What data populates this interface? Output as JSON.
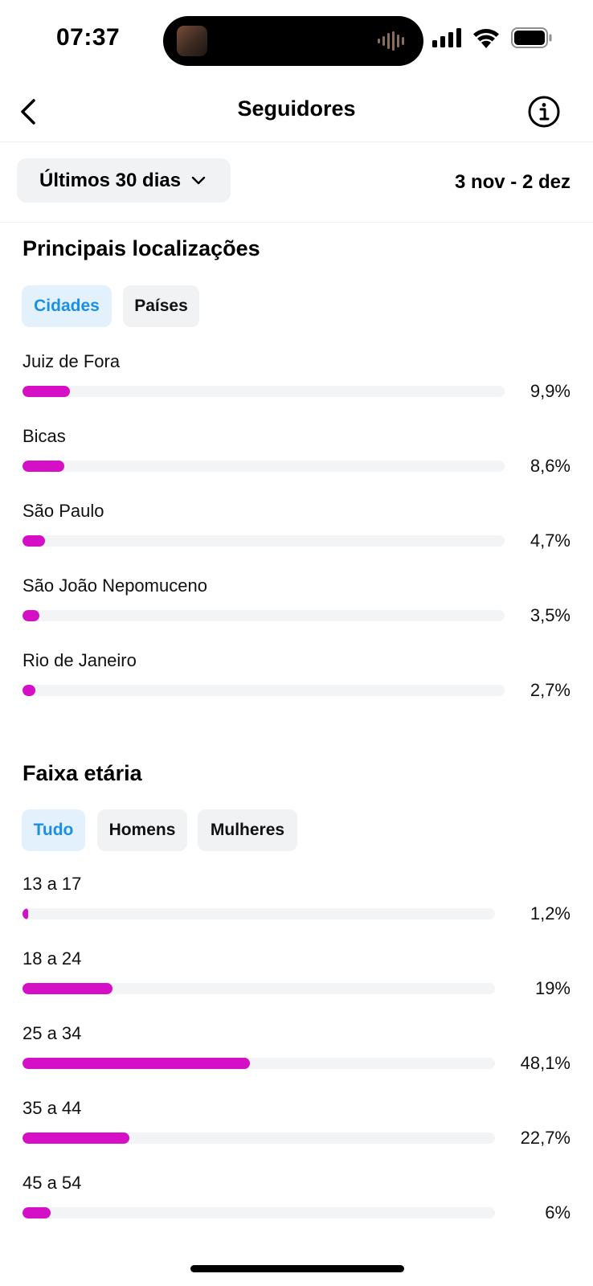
{
  "status_bar": {
    "time": "07:37"
  },
  "header": {
    "title": "Seguidores"
  },
  "filter": {
    "range_label": "Últimos 30 dias",
    "date_range": "3 nov - 2 dez"
  },
  "locations": {
    "title": "Principais localizações",
    "tabs": [
      {
        "label": "Cidades",
        "active": true
      },
      {
        "label": "Países",
        "active": false
      }
    ],
    "rows": [
      {
        "label": "Juiz de Fora",
        "percent_text": "9,9%",
        "value": 9.9
      },
      {
        "label": "Bicas",
        "percent_text": "8,6%",
        "value": 8.6
      },
      {
        "label": "São Paulo",
        "percent_text": "4,7%",
        "value": 4.7
      },
      {
        "label": "São João Nepomuceno",
        "percent_text": "3,5%",
        "value": 3.5
      },
      {
        "label": "Rio de Janeiro",
        "percent_text": "2,7%",
        "value": 2.7
      }
    ]
  },
  "age": {
    "title": "Faixa etária",
    "tabs": [
      {
        "label": "Tudo",
        "active": true
      },
      {
        "label": "Homens",
        "active": false
      },
      {
        "label": "Mulheres",
        "active": false
      }
    ],
    "rows": [
      {
        "label": "13 a 17",
        "percent_text": "1,2%",
        "value": 1.2
      },
      {
        "label": "18 a 24",
        "percent_text": "19%",
        "value": 19
      },
      {
        "label": "25 a 34",
        "percent_text": "48,1%",
        "value": 48.1
      },
      {
        "label": "35 a 44",
        "percent_text": "22,7%",
        "value": 22.7
      },
      {
        "label": "45 a 54",
        "percent_text": "6%",
        "value": 6
      }
    ]
  },
  "colors": {
    "bar": "#d50fc6",
    "track": "#f3f4f6",
    "active_chip_text": "#1a8fe3",
    "active_chip_bg": "#e3f1fc"
  },
  "icons": {
    "back": "chevron-left-icon",
    "info": "info-icon",
    "dropdown": "chevron-down-icon"
  }
}
